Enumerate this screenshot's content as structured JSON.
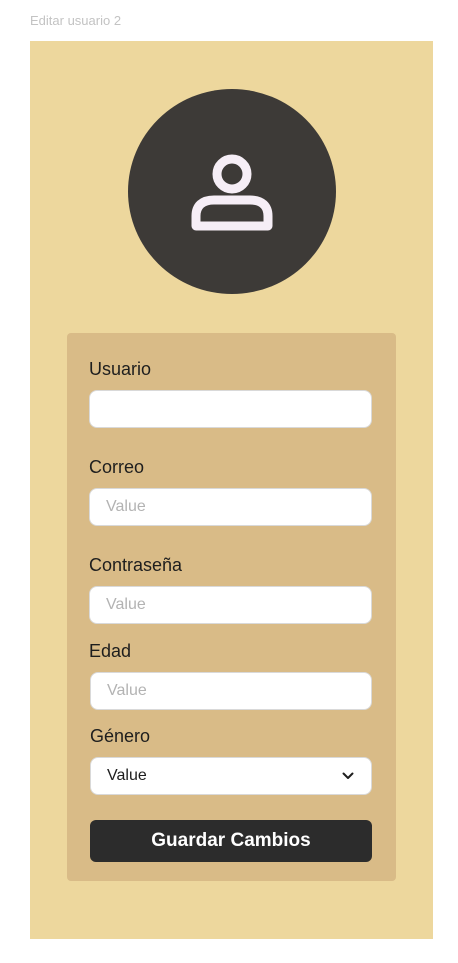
{
  "frame_title": "Editar usuario 2",
  "avatar": {
    "icon": "user-icon",
    "bg_color": "#3d3a37",
    "icon_color": "#f6eef6"
  },
  "form": {
    "usuario": {
      "label": "Usuario",
      "value": "",
      "placeholder": ""
    },
    "correo": {
      "label": "Correo",
      "placeholder": "Value"
    },
    "contrasena": {
      "label": "Contraseña",
      "placeholder": "Value"
    },
    "edad": {
      "label": "Edad",
      "placeholder": "Value"
    },
    "genero": {
      "label": "Género",
      "selected": "Value",
      "icon": "chevron-down-icon"
    },
    "save_label": "Guardar Cambios"
  },
  "colors": {
    "frame_bg": "#edd79d",
    "card_bg": "#d9bb87",
    "button_bg": "#2c2c2c"
  }
}
